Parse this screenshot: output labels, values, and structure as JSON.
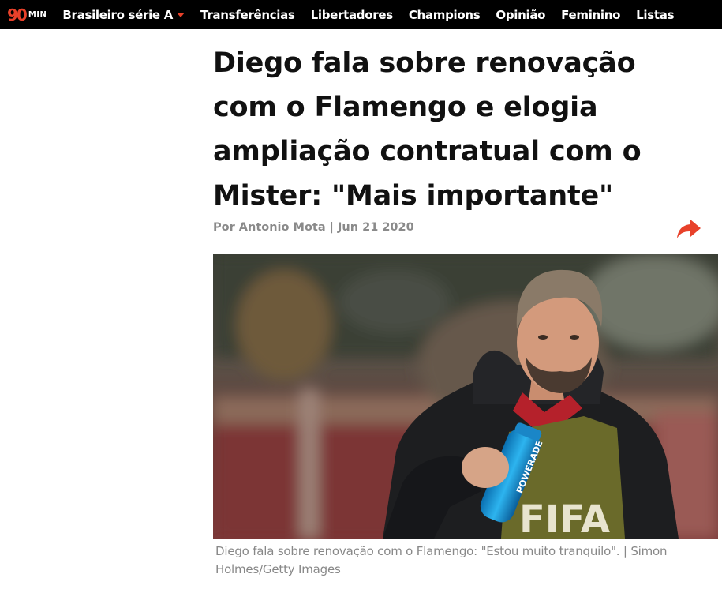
{
  "colors": {
    "accent": "#e8412a",
    "nav_bg": "#000000",
    "headline": "#111111",
    "meta": "#8a8a8a"
  },
  "logo": {
    "number": "90",
    "suffix": "MIN"
  },
  "nav": {
    "items": [
      {
        "label": "Brasileiro série A",
        "dropdown": true
      },
      {
        "label": "Transferências"
      },
      {
        "label": "Libertadores"
      },
      {
        "label": "Champions"
      },
      {
        "label": "Opinião"
      },
      {
        "label": "Feminino"
      },
      {
        "label": "Listas"
      }
    ]
  },
  "article": {
    "headline_lines": [
      "Diego fala sobre renovação",
      "com o Flamengo e elogia",
      "ampliação contratual com o",
      "Mister: \"Mais importante\""
    ],
    "byline": "Por Antonio Mota | Jun 21 2020",
    "share_icon": "share-arrow-icon",
    "image": {
      "shirt_text": "FIFA",
      "bottle_text": "POWERADE"
    },
    "caption_lines": [
      "Diego fala sobre renovação com o Flamengo: \"Estou muito tranquilo\". | Simon",
      "Holmes/Getty Images"
    ]
  }
}
